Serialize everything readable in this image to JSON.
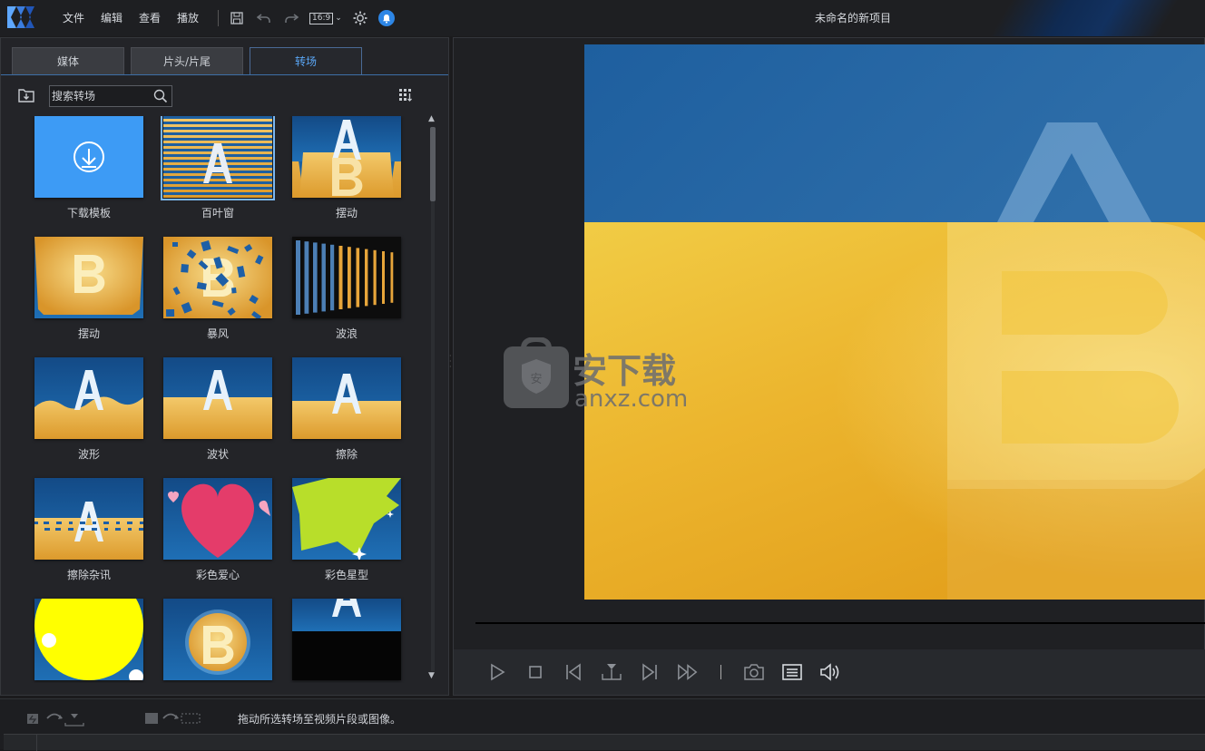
{
  "app": {
    "menu": [
      "文件",
      "编辑",
      "查看",
      "播放"
    ],
    "aspect_ratio": "16:9",
    "project_title": "未命名的新项目"
  },
  "library": {
    "tabs": [
      {
        "label": "媒体",
        "active": false
      },
      {
        "label": "片头/片尾",
        "active": false
      },
      {
        "label": "转场",
        "active": true
      }
    ],
    "search_placeholder": "搜索转场",
    "items": [
      {
        "label": "下载模板",
        "style": "download",
        "selected": false
      },
      {
        "label": "百叶窗",
        "style": "blinds",
        "selected": true
      },
      {
        "label": "摆动",
        "style": "swing-a",
        "selected": false
      },
      {
        "label": "摆动",
        "style": "swing-b",
        "selected": false
      },
      {
        "label": "暴风",
        "style": "storm",
        "selected": false
      },
      {
        "label": "波浪",
        "style": "wave-bars",
        "selected": false
      },
      {
        "label": "波形",
        "style": "waveform",
        "selected": false
      },
      {
        "label": "波状",
        "style": "wavy",
        "selected": false
      },
      {
        "label": "擦除",
        "style": "wipe",
        "selected": false
      },
      {
        "label": "擦除杂讯",
        "style": "wipe-noise",
        "selected": false
      },
      {
        "label": "彩色爱心",
        "style": "hearts",
        "selected": false
      },
      {
        "label": "彩色星型",
        "style": "stars",
        "selected": false
      },
      {
        "label": "",
        "style": "yellow-circle",
        "selected": false
      },
      {
        "label": "",
        "style": "circle-b",
        "selected": false
      },
      {
        "label": "",
        "style": "slide-a",
        "selected": false
      }
    ]
  },
  "status": {
    "hint": "拖动所选转场至视频片段或图像。"
  },
  "watermark": {
    "cn": "安下载",
    "en": "anxz.com",
    "badge": "安"
  },
  "colors": {
    "accent": "#5aa6f5",
    "blue": "#1f5f9e",
    "gold": "#e9a93a"
  }
}
